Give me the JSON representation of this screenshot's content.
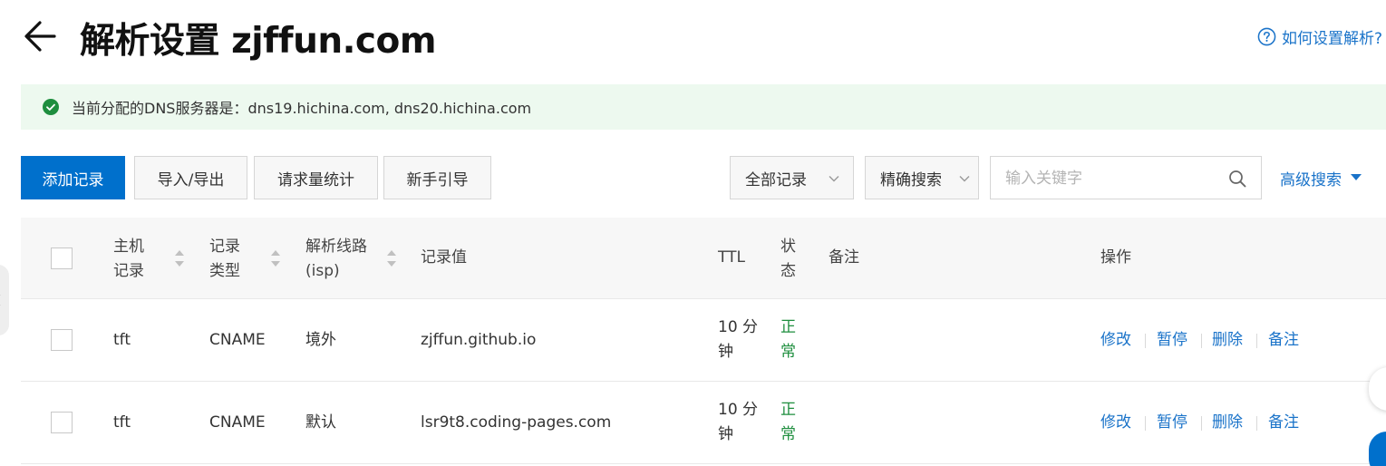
{
  "header": {
    "back_icon": "arrow-left-icon",
    "title": "解析设置 zjffun.com",
    "help_icon": "question-circle-icon",
    "help_label": "如何设置解析?"
  },
  "notice": {
    "icon": "check-circle-icon",
    "text": "当前分配的DNS服务器是：dns19.hichina.com, dns20.hichina.com",
    "colors": {
      "background": "#edf9ef",
      "icon": "#1e8e3e"
    }
  },
  "toolbar": {
    "add_record": "添加记录",
    "import_export": "导入/导出",
    "request_stats": "请求量统计",
    "beginner_guide": "新手引导",
    "record_filter": "全部记录",
    "search_mode": "精确搜索",
    "search_placeholder": "输入关键字",
    "advanced_search": "高级搜索",
    "colors": {
      "primary": "#0070cc",
      "link": "#1a73c9"
    }
  },
  "table": {
    "columns": {
      "host_line1": "主机",
      "host_line2": "记录",
      "type_line1": "记录",
      "type_line2": "类型",
      "line_line1": "解析线路",
      "line_line2": "(isp)",
      "value": "记录值",
      "ttl": "TTL",
      "status_line1": "状",
      "status_line2": "态",
      "remark": "备注",
      "actions": "操作"
    },
    "rows": [
      {
        "host": "tft",
        "type": "CNAME",
        "line": "境外",
        "value": "zjffun.github.io",
        "ttl_line1": "10 分",
        "ttl_line2": "钟",
        "status_line1": "正",
        "status_line2": "常",
        "actions": {
          "edit": "修改",
          "pause": "暂停",
          "delete": "删除",
          "remark": "备注"
        }
      },
      {
        "host": "tft",
        "type": "CNAME",
        "line": "默认",
        "value": "lsr9t8.coding-pages.com",
        "ttl_line1": "10 分",
        "ttl_line2": "钟",
        "status_line1": "正",
        "status_line2": "常",
        "actions": {
          "edit": "修改",
          "pause": "暂停",
          "delete": "删除",
          "remark": "备注"
        }
      }
    ],
    "colors": {
      "header_bg": "#f7f7f7",
      "status_ok": "#1e8e3e"
    }
  }
}
